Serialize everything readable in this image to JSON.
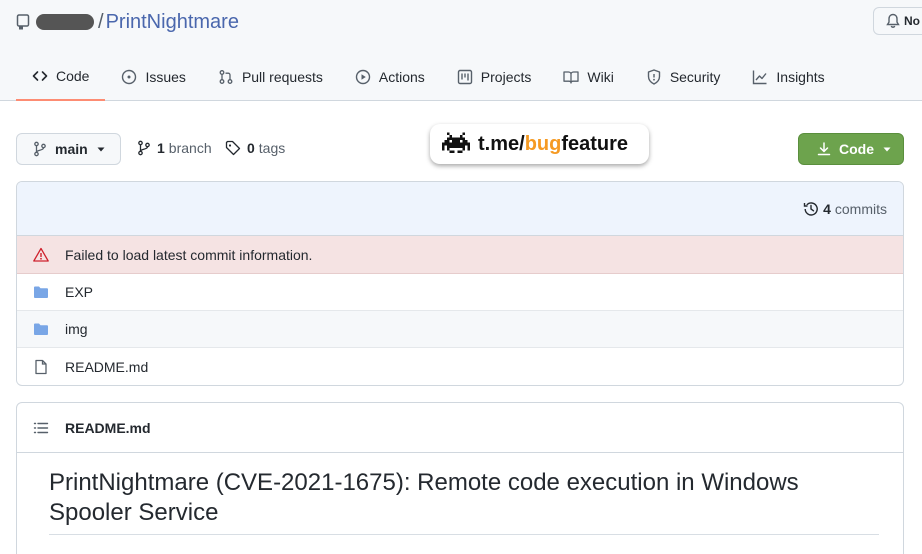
{
  "repo": {
    "name": "PrintNightmare",
    "slash": "/"
  },
  "notifications": {
    "label": "No"
  },
  "tabs": [
    {
      "label": "Code",
      "icon": "code-icon",
      "selected": true
    },
    {
      "label": "Issues",
      "icon": "issue-icon"
    },
    {
      "label": "Pull requests",
      "icon": "pull-request-icon"
    },
    {
      "label": "Actions",
      "icon": "play-icon"
    },
    {
      "label": "Projects",
      "icon": "project-icon"
    },
    {
      "label": "Wiki",
      "icon": "book-icon"
    },
    {
      "label": "Security",
      "icon": "shield-icon"
    },
    {
      "label": "Insights",
      "icon": "graph-icon"
    }
  ],
  "toolbar": {
    "branch_button": "main",
    "branch_count": "1",
    "branch_word": "branch",
    "tag_count": "0",
    "tag_word": "tags",
    "code_button": "Code"
  },
  "watermark": {
    "prefix": "t.me/",
    "accent": "bug",
    "suffix": "feature"
  },
  "commits": {
    "count": "4",
    "word": "commits"
  },
  "error_message": "Failed to load latest commit information.",
  "files": [
    {
      "name": "EXP",
      "type": "folder"
    },
    {
      "name": "img",
      "type": "folder"
    },
    {
      "name": "README.md",
      "type": "file"
    }
  ],
  "readme": {
    "filename": "README.md",
    "heading": "PrintNightmare (CVE-2021-1675): Remote code execution in Windows Spooler Service"
  },
  "colors": {
    "repo_link": "#4a67ad",
    "code_button": "#6da34d",
    "tab_underline": "#fd8c73",
    "error_bg": "#f5e3e3",
    "folder": "#79a6e6",
    "accent": "#f59a23"
  }
}
